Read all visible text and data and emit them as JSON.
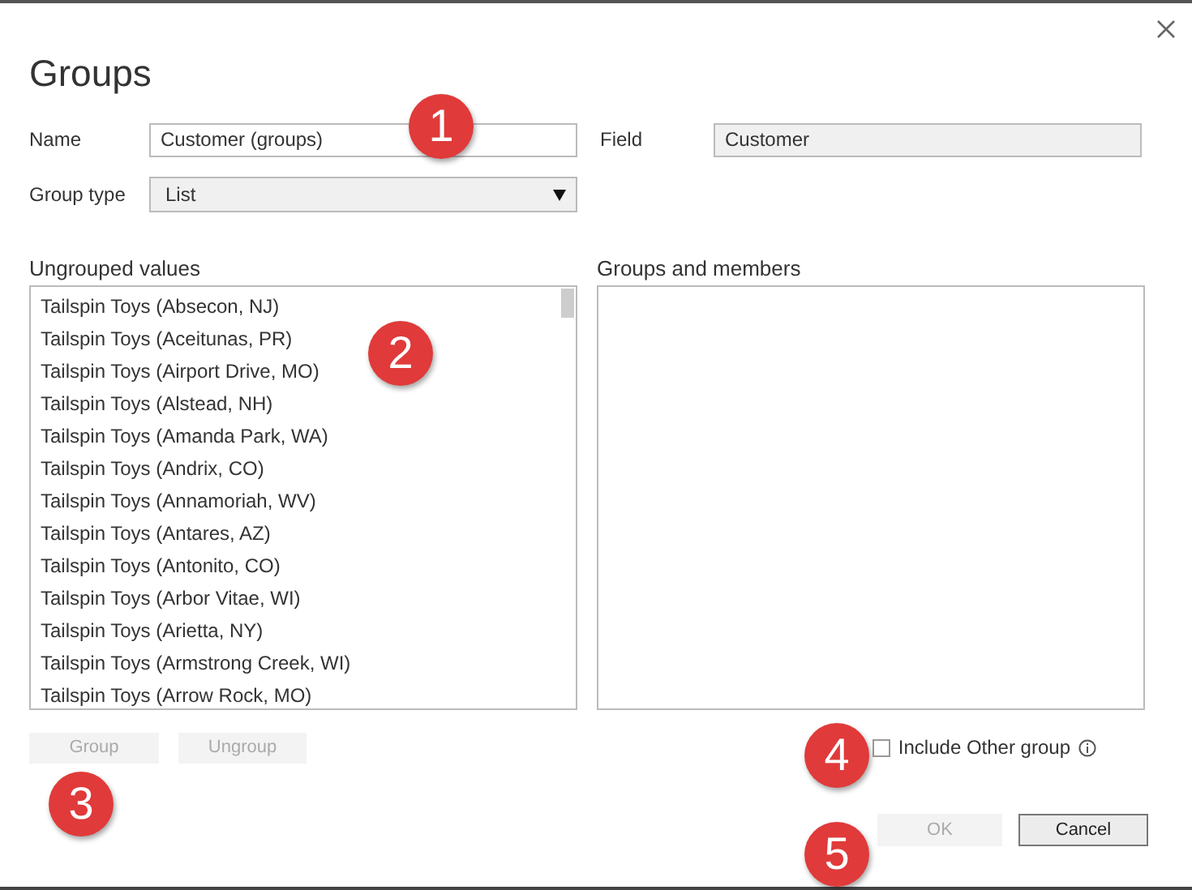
{
  "dialog": {
    "title": "Groups"
  },
  "name_field": {
    "label": "Name",
    "value": "Customer (groups)"
  },
  "field_field": {
    "label": "Field",
    "value": "Customer",
    "disabled": true
  },
  "group_type": {
    "label": "Group type",
    "value": "List"
  },
  "ungrouped": {
    "heading": "Ungrouped values",
    "items": [
      {
        "label": "Tailspin Toys (Absecon, NJ)",
        "selected": false
      },
      {
        "label": "Tailspin Toys (Aceitunas, PR)",
        "selected": false
      },
      {
        "label": "Tailspin Toys (Airport Drive, MO)",
        "selected": false
      },
      {
        "label": "Tailspin Toys (Alstead, NH)",
        "selected": false
      },
      {
        "label": "Tailspin Toys (Amanda Park, WA)",
        "selected": false
      },
      {
        "label": "Tailspin Toys (Andrix, CO)",
        "selected": false
      },
      {
        "label": "Tailspin Toys (Annamoriah, WV)",
        "selected": false
      },
      {
        "label": "Tailspin Toys (Antares, AZ)",
        "selected": false
      },
      {
        "label": "Tailspin Toys (Antonito, CO)",
        "selected": false
      },
      {
        "label": "Tailspin Toys (Arbor Vitae, WI)",
        "selected": false
      },
      {
        "label": "Tailspin Toys (Arietta, NY)",
        "selected": false
      },
      {
        "label": "Tailspin Toys (Armstrong Creek, WI)",
        "selected": false
      },
      {
        "label": "Tailspin Toys (Arrow Rock, MO)",
        "selected": false
      }
    ]
  },
  "groups_and_members": {
    "heading": "Groups and members"
  },
  "list_buttons": [
    {
      "label": "Group",
      "disabled": true
    },
    {
      "label": "Ungroup",
      "disabled": true
    }
  ],
  "include_other": {
    "label": "Include Other group",
    "checked": false
  },
  "footer_buttons": [
    {
      "label": "OK",
      "disabled": true
    },
    {
      "label": "Cancel",
      "disabled": false
    }
  ],
  "callouts": [
    "1",
    "2",
    "3",
    "4",
    "5"
  ]
}
